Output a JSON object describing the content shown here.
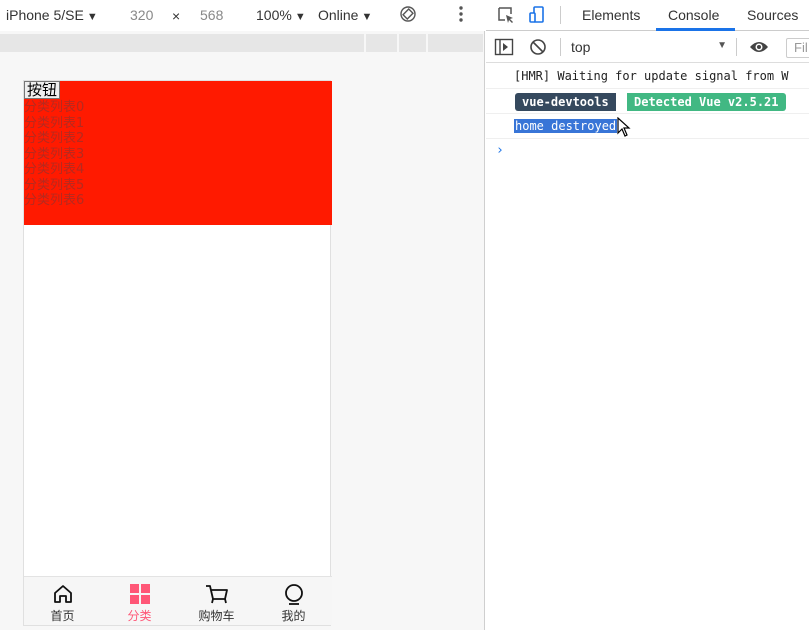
{
  "device_toolbar": {
    "device": "iPhone 5/SE",
    "width": "320",
    "times": "×",
    "height": "568",
    "zoom": "100%",
    "throttle": "Online"
  },
  "phone": {
    "button_label": "按钮",
    "category_items": [
      "分类列表0",
      "分类列表1",
      "分类列表2",
      "分类列表3",
      "分类列表4",
      "分类列表5",
      "分类列表6"
    ],
    "block_color": "#ff1a00",
    "tabs": [
      {
        "label": "首页",
        "icon": "home-icon",
        "active": false
      },
      {
        "label": "分类",
        "icon": "category-icon",
        "active": true
      },
      {
        "label": "购物车",
        "icon": "cart-icon",
        "active": false
      },
      {
        "label": "我的",
        "icon": "profile-icon",
        "active": false
      }
    ],
    "active_tab_color": "#ff5777"
  },
  "devtools": {
    "tabs": [
      "Elements",
      "Console",
      "Sources"
    ],
    "active_tab": "Console",
    "context": "top",
    "filter_placeholder": "Fil",
    "log": {
      "hmr": "[HMR] Waiting for update signal from W",
      "badge_left": "vue-devtools",
      "badge_right": "Detected Vue v2.5.21",
      "destroyed": "home destroyed"
    },
    "prompt": "›"
  }
}
